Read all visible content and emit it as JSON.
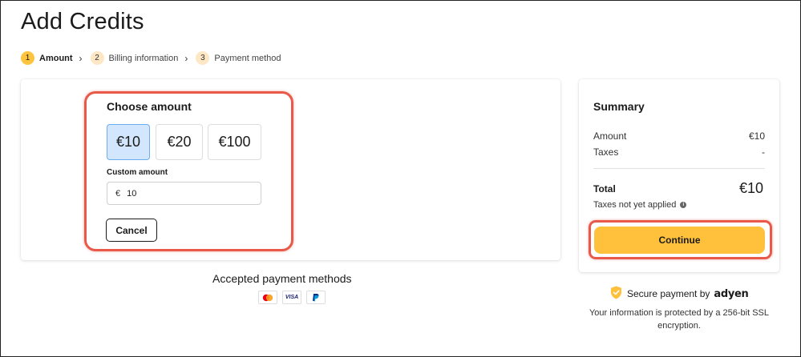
{
  "page": {
    "title": "Add Credits"
  },
  "stepper": {
    "steps": [
      {
        "num": "1",
        "label": "Amount"
      },
      {
        "num": "2",
        "label": "Billing information"
      },
      {
        "num": "3",
        "label": "Payment method"
      }
    ],
    "separator": "›"
  },
  "amount_section": {
    "title": "Choose amount",
    "options": [
      "€10",
      "€20",
      "€100"
    ],
    "selected": "€10",
    "custom_label": "Custom amount",
    "custom_currency": "€",
    "custom_value": "10",
    "cancel_label": "Cancel"
  },
  "payment_methods": {
    "title": "Accepted payment methods",
    "icons": [
      "mastercard-icon",
      "visa-icon",
      "paypal-icon"
    ],
    "visa_text": "VISA"
  },
  "summary": {
    "title": "Summary",
    "amount_label": "Amount",
    "amount_value": "€10",
    "taxes_label": "Taxes",
    "taxes_value": "-",
    "total_label": "Total",
    "total_value": "€10",
    "taxes_note": "Taxes not yet applied",
    "continue_label": "Continue"
  },
  "secure": {
    "text": "Secure payment by",
    "brand": "adyen",
    "description": "Your information is protected by a 256-bit SSL encryption."
  },
  "colors": {
    "accent": "#ffc13b",
    "selected_bg": "#d2e7fd",
    "highlight": "#e8594a"
  }
}
